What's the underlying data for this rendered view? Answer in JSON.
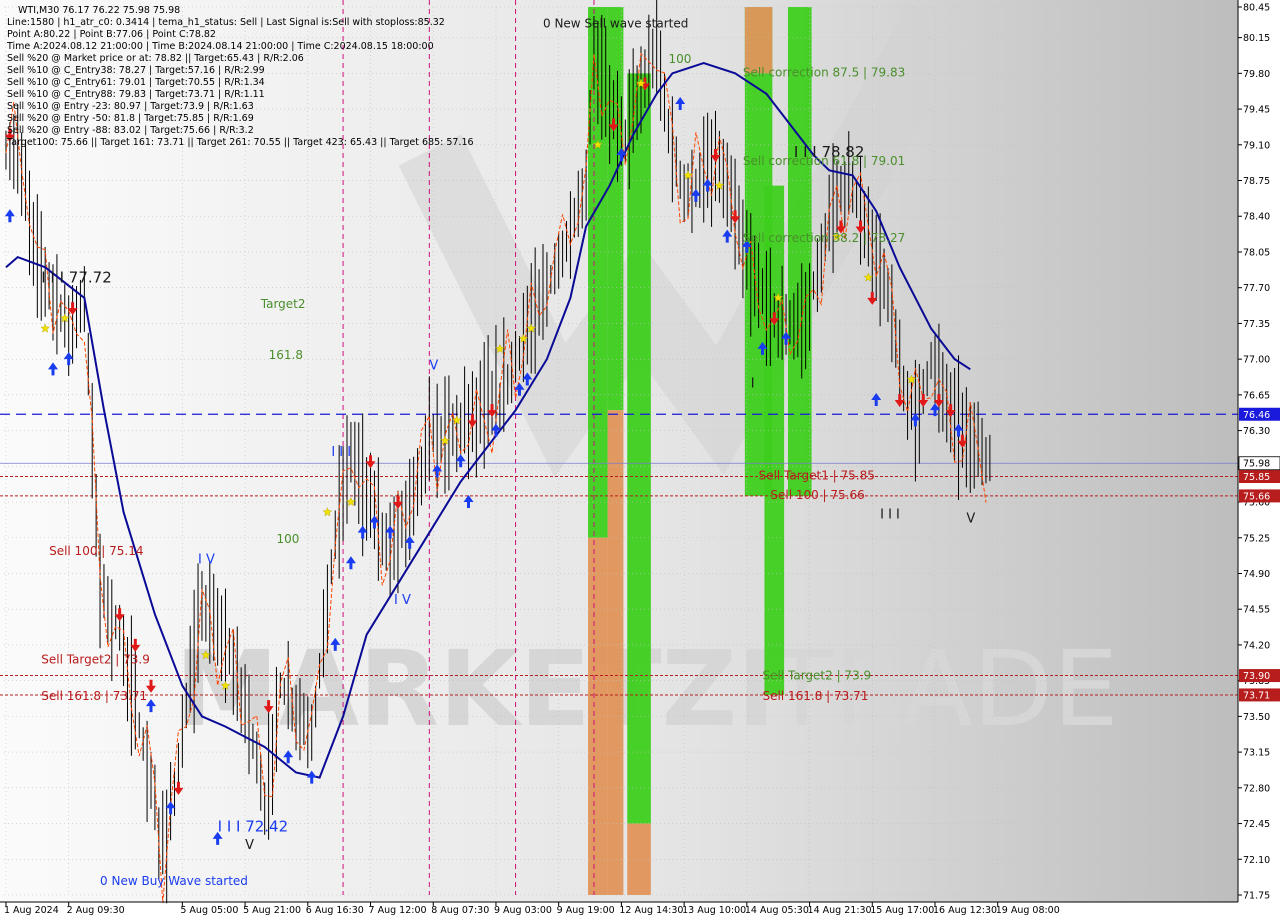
{
  "colors": {
    "background": "#ffffff",
    "plot_gradient_light": "#f4f4f4",
    "plot_gradient_dark": "#b6b6b6",
    "candle": "#000000",
    "moving_average": "#0a0a96",
    "signal_line": "#ff4500",
    "grid": "#c0c0c0",
    "period_separator": "#d0107a",
    "zone_green": "#3ecf1e",
    "zone_orange": "#e0955a",
    "blue_dashed": "#1a1adc",
    "level_red": "#b81d1d",
    "current_price_bg": "#ffffff",
    "label_green": "#4a8f2c",
    "label_red": "#b81d1d",
    "buy_arrow": "#1a3cf0",
    "sell_arrow": "#e01818",
    "star": "#f0e000",
    "watermark": "#d6d6d6"
  },
  "info_panel": {
    "lines": [
      "WTI,M30  76.17 76.22 75.98 75.98",
      "Line:1580 | h1_atr_c0: 0.3414 | tema_h1_status: Sell | Last Signal is:Sell with stoploss:85.32",
      "Point A:80.22 | Point B:77.06 | Point C:78.82",
      "Time A:2024.08.12 21:00:00 | Time B:2024.08.14 21:00:00 | Time C:2024.08.15 18:00:00",
      "Sell %20 @ Market price or at: 78.82 || Target:65.43 | R/R:2.06",
      "Sell %10 @ C_Entry38: 78.27 | Target:57.16 | R/R:2.99",
      "Sell %10 @ C_Entry61: 79.01 | Target:70.55 | R/R:1.34",
      "Sell %10 @ C_Entry88: 79.83 | Target:73.71 | R/R:1.11",
      "Sell %10 @ Entry -23: 80.97 | Target:73.9 | R/R:1.63",
      "Sell %20 @ Entry -50: 81.8 | Target:75.85 | R/R:1.69",
      "Sell %20 @ Entry -88: 83.02 | Target:75.66 | R/R:3.2",
      "Target100: 75.66 || Target 161: 73.71 || Target 261: 70.55 || Target 423: 65.43 || Target 685: 57.16"
    ]
  },
  "watermark": {
    "brand": "MARKETZI",
    "suffix": "TRADE"
  },
  "chart_data": {
    "type": "candlestick",
    "symbol": "WTI",
    "timeframe": "M30",
    "ylim": [
      71.75,
      80.45
    ],
    "y_ticks": [
      "80.45",
      "80.15",
      "79.80",
      "79.45",
      "79.10",
      "78.75",
      "78.40",
      "78.05",
      "77.70",
      "77.35",
      "77.00",
      "76.65",
      "76.30",
      "75.95",
      "75.60",
      "75.25",
      "74.90",
      "74.55",
      "74.20",
      "73.85",
      "73.50",
      "73.15",
      "72.80",
      "72.45",
      "72.10",
      "71.75"
    ],
    "x_ticks": [
      "1 Aug 2024",
      "2 Aug 09:30",
      "5 Aug 05:00",
      "5 Aug 21:00",
      "6 Aug 16:30",
      "7 Aug 12:00",
      "8 Aug 07:30",
      "9 Aug 03:00",
      "9 Aug 19:00",
      "12 Aug 14:30",
      "13 Aug 10:00",
      "14 Aug 05:30",
      "14 Aug 21:30",
      "15 Aug 17:00",
      "16 Aug 12:30",
      "19 Aug 08:00"
    ],
    "x_tick_bars": [
      0,
      16,
      45,
      61,
      77,
      93,
      109,
      125,
      141,
      157,
      173,
      189,
      205,
      221,
      237,
      253
    ],
    "total_bars": 252,
    "price_path": [
      [
        0,
        79.0
      ],
      [
        3,
        79.05
      ],
      [
        8,
        78.0
      ],
      [
        16,
        77.3
      ],
      [
        20,
        77.6
      ],
      [
        24,
        74.8
      ],
      [
        30,
        74.2
      ],
      [
        35,
        73.2
      ],
      [
        40,
        72.2
      ],
      [
        44,
        73.0
      ],
      [
        50,
        74.6
      ],
      [
        56,
        74.2
      ],
      [
        62,
        73.5
      ],
      [
        66,
        72.6
      ],
      [
        70,
        73.8
      ],
      [
        78,
        73.3
      ],
      [
        84,
        75.3
      ],
      [
        88,
        76.1
      ],
      [
        94,
        75.5
      ],
      [
        98,
        75.1
      ],
      [
        104,
        75.7
      ],
      [
        108,
        76.2
      ],
      [
        114,
        76.3
      ],
      [
        120,
        76.5
      ],
      [
        126,
        76.6
      ],
      [
        132,
        77.2
      ],
      [
        138,
        77.7
      ],
      [
        144,
        78.2
      ],
      [
        148,
        78.7
      ],
      [
        150,
        80.0
      ],
      [
        154,
        79.5
      ],
      [
        158,
        79.2
      ],
      [
        162,
        79.6
      ],
      [
        166,
        80.05
      ],
      [
        170,
        79.0
      ],
      [
        174,
        78.6
      ],
      [
        178,
        78.8
      ],
      [
        182,
        78.9
      ],
      [
        186,
        78.4
      ],
      [
        190,
        77.8
      ],
      [
        194,
        77.6
      ],
      [
        198,
        77.3
      ],
      [
        204,
        77.4
      ],
      [
        208,
        78.0
      ],
      [
        212,
        78.6
      ],
      [
        216,
        78.7
      ],
      [
        220,
        78.2
      ],
      [
        224,
        77.8
      ],
      [
        228,
        76.9
      ],
      [
        232,
        76.4
      ],
      [
        236,
        77.0
      ],
      [
        240,
        76.6
      ],
      [
        244,
        76.3
      ],
      [
        248,
        76.1
      ],
      [
        252,
        75.98
      ]
    ],
    "moving_average": [
      [
        0,
        77.9
      ],
      [
        3,
        78.0
      ],
      [
        10,
        77.9
      ],
      [
        20,
        77.6
      ],
      [
        25,
        76.5
      ],
      [
        30,
        75.5
      ],
      [
        38,
        74.5
      ],
      [
        45,
        73.8
      ],
      [
        50,
        73.5
      ],
      [
        56,
        73.4
      ],
      [
        66,
        73.2
      ],
      [
        74,
        72.95
      ],
      [
        80,
        72.9
      ],
      [
        86,
        73.5
      ],
      [
        92,
        74.3
      ],
      [
        100,
        74.8
      ],
      [
        108,
        75.3
      ],
      [
        116,
        75.8
      ],
      [
        122,
        76.1
      ],
      [
        130,
        76.5
      ],
      [
        138,
        77.0
      ],
      [
        144,
        77.6
      ],
      [
        148,
        78.3
      ],
      [
        154,
        78.7
      ],
      [
        160,
        79.2
      ],
      [
        166,
        79.6
      ],
      [
        170,
        79.8
      ],
      [
        178,
        79.9
      ],
      [
        186,
        79.8
      ],
      [
        194,
        79.6
      ],
      [
        200,
        79.3
      ],
      [
        206,
        79.0
      ],
      [
        210,
        78.85
      ],
      [
        216,
        78.8
      ],
      [
        222,
        78.45
      ],
      [
        228,
        77.9
      ],
      [
        236,
        77.3
      ],
      [
        242,
        77.0
      ],
      [
        246,
        76.9
      ]
    ],
    "current_price": {
      "value": 75.98,
      "label": "75.98"
    },
    "dashed_level": {
      "value": 76.46,
      "label": "76.46"
    },
    "levels": [
      {
        "value": 75.85,
        "label": "75.85"
      },
      {
        "value": 75.66,
        "label": "75.66"
      },
      {
        "value": 73.9,
        "label": "73.90"
      },
      {
        "value": 73.71,
        "label": "73.71"
      }
    ],
    "period_separators": [
      86,
      108,
      130,
      150
    ],
    "zones": [
      {
        "bar_from": 149,
        "bar_to": 153,
        "y_from": 80.45,
        "y_to": 75.25,
        "color": "zone_green"
      },
      {
        "bar_from": 149,
        "bar_to": 153,
        "y_from": 75.25,
        "y_to": 71.75,
        "color": "zone_orange"
      },
      {
        "bar_from": 154,
        "bar_to": 157,
        "y_from": 80.45,
        "y_to": 76.5,
        "color": "zone_green"
      },
      {
        "bar_from": 154,
        "bar_to": 157,
        "y_from": 76.5,
        "y_to": 71.75,
        "color": "zone_orange"
      },
      {
        "bar_from": 159,
        "bar_to": 164,
        "y_from": 79.8,
        "y_to": 72.45,
        "color": "zone_green"
      },
      {
        "bar_from": 159,
        "bar_to": 164,
        "y_from": 72.45,
        "y_to": 71.75,
        "color": "zone_orange"
      },
      {
        "bar_from": 189,
        "bar_to": 195,
        "y_from": 80.45,
        "y_to": 75.66,
        "color": "zone_green"
      },
      {
        "bar_from": 189,
        "bar_to": 195,
        "y_from": 80.45,
        "y_to": 79.8,
        "color": "zone_orange"
      },
      {
        "bar_from": 194,
        "bar_to": 198,
        "y_from": 78.7,
        "y_to": 73.71,
        "color": "zone_green"
      },
      {
        "bar_from": 200,
        "bar_to": 205,
        "y_from": 80.45,
        "y_to": 75.66,
        "color": "zone_green"
      }
    ],
    "labels": [
      {
        "text": "0 New Sell wave started",
        "bar": 137,
        "y": 80.25,
        "color": "label_black"
      },
      {
        "text": "100",
        "bar": 169,
        "y": 79.9,
        "color": "label_green"
      },
      {
        "text": "Sell correction 87.5 | 79.83",
        "bar": 188,
        "y": 79.77,
        "color": "label_green"
      },
      {
        "text": "I I I 78.82",
        "bar": 201,
        "y": 78.98,
        "color": "label_black"
      },
      {
        "text": "Sell correction 61.8 | 79.01",
        "bar": 188,
        "y": 78.9,
        "color": "label_green"
      },
      {
        "text": "Sell correction 38.2 | 78.27",
        "bar": 188,
        "y": 78.15,
        "color": "label_green"
      },
      {
        "text": "I I I 77.72",
        "bar": 9,
        "y": 77.75,
        "color": "label_black"
      },
      {
        "text": "Target2",
        "bar": 65,
        "y": 77.5,
        "color": "label_green"
      },
      {
        "text": "161.8",
        "bar": 67,
        "y": 77.0,
        "color": "label_green"
      },
      {
        "text": "V",
        "bar": 108,
        "y": 76.9,
        "color": "label_blue"
      },
      {
        "text": "I",
        "bar": 190,
        "y": 76.72,
        "color": "label_black"
      },
      {
        "text": "I I I",
        "bar": 83,
        "y": 76.05,
        "color": "label_blue"
      },
      {
        "text": "Sell Target1 | 75.85",
        "bar": 192,
        "y": 75.82,
        "color": "label_red"
      },
      {
        "text": "Sell 100 | 75.66",
        "bar": 195,
        "y": 75.63,
        "color": "label_red"
      },
      {
        "text": "I I I",
        "bar": 223,
        "y": 75.44,
        "color": "label_black"
      },
      {
        "text": "V",
        "bar": 245,
        "y": 75.4,
        "color": "label_black"
      },
      {
        "text": "100",
        "bar": 69,
        "y": 75.2,
        "color": "label_green"
      },
      {
        "text": "Sell 100 | 75.14",
        "bar": 11,
        "y": 75.08,
        "color": "label_red"
      },
      {
        "text": "I V",
        "bar": 49,
        "y": 75.0,
        "color": "label_blue"
      },
      {
        "text": "I V",
        "bar": 99,
        "y": 74.6,
        "color": "label_blue"
      },
      {
        "text": "Sell Target2 | 73.9",
        "bar": 9,
        "y": 74.02,
        "color": "label_red"
      },
      {
        "text": "Sell Target2 | 73.9",
        "bar": 193,
        "y": 73.86,
        "color": "label_green"
      },
      {
        "text": "Sell 161.8 | 73.71",
        "bar": 193,
        "y": 73.66,
        "color": "label_red"
      },
      {
        "text": "Sell 161.8 | 73.71",
        "bar": 9,
        "y": 73.66,
        "color": "label_red"
      },
      {
        "text": "I I I 72.42",
        "bar": 54,
        "y": 72.37,
        "color": "label_blue"
      },
      {
        "text": "V",
        "bar": 61,
        "y": 72.2,
        "color": "label_black"
      },
      {
        "text": "0 New Buy Wave started",
        "bar": 24,
        "y": 71.85,
        "color": "label_blue"
      }
    ],
    "buy_arrows": [
      [
        1,
        78.4
      ],
      [
        12,
        76.9
      ],
      [
        16,
        77.0
      ],
      [
        37,
        73.6
      ],
      [
        42,
        72.6
      ],
      [
        54,
        72.3
      ],
      [
        72,
        73.1
      ],
      [
        78,
        72.9
      ],
      [
        84,
        74.2
      ],
      [
        88,
        75.0
      ],
      [
        91,
        75.3
      ],
      [
        94,
        75.4
      ],
      [
        98,
        75.3
      ],
      [
        103,
        75.2
      ],
      [
        110,
        75.9
      ],
      [
        116,
        76.0
      ],
      [
        118,
        75.6
      ],
      [
        125,
        76.3
      ],
      [
        131,
        76.7
      ],
      [
        133,
        76.8
      ],
      [
        157,
        79.0
      ],
      [
        172,
        79.5
      ],
      [
        176,
        78.6
      ],
      [
        179,
        78.7
      ],
      [
        184,
        78.2
      ],
      [
        189,
        78.1
      ],
      [
        193,
        77.1
      ],
      [
        199,
        77.2
      ],
      [
        222,
        76.6
      ],
      [
        232,
        76.4
      ],
      [
        237,
        76.5
      ],
      [
        243,
        76.3
      ]
    ],
    "sell_arrows": [
      [
        1,
        79.2
      ],
      [
        17,
        77.5
      ],
      [
        29,
        74.5
      ],
      [
        33,
        74.2
      ],
      [
        37,
        73.8
      ],
      [
        44,
        72.8
      ],
      [
        67,
        73.6
      ],
      [
        93,
        76.0
      ],
      [
        100,
        75.6
      ],
      [
        119,
        76.4
      ],
      [
        124,
        76.5
      ],
      [
        155,
        79.3
      ],
      [
        163,
        79.7
      ],
      [
        181,
        79.0
      ],
      [
        186,
        78.4
      ],
      [
        196,
        77.4
      ],
      [
        213,
        78.3
      ],
      [
        218,
        78.3
      ],
      [
        221,
        77.6
      ],
      [
        228,
        76.6
      ],
      [
        234,
        76.6
      ],
      [
        238,
        76.6
      ],
      [
        241,
        76.5
      ],
      [
        244,
        76.2
      ]
    ],
    "stars": [
      [
        10,
        77.3
      ],
      [
        15,
        77.4
      ],
      [
        51,
        74.1
      ],
      [
        56,
        73.8
      ],
      [
        82,
        75.5
      ],
      [
        88,
        75.6
      ],
      [
        112,
        76.2
      ],
      [
        115,
        76.4
      ],
      [
        126,
        77.1
      ],
      [
        132,
        77.2
      ],
      [
        134,
        77.3
      ],
      [
        151,
        79.1
      ],
      [
        162,
        79.7
      ],
      [
        174,
        78.8
      ],
      [
        182,
        78.7
      ],
      [
        197,
        77.6
      ],
      [
        212,
        78.2
      ],
      [
        220,
        77.8
      ],
      [
        231,
        76.8
      ]
    ]
  }
}
